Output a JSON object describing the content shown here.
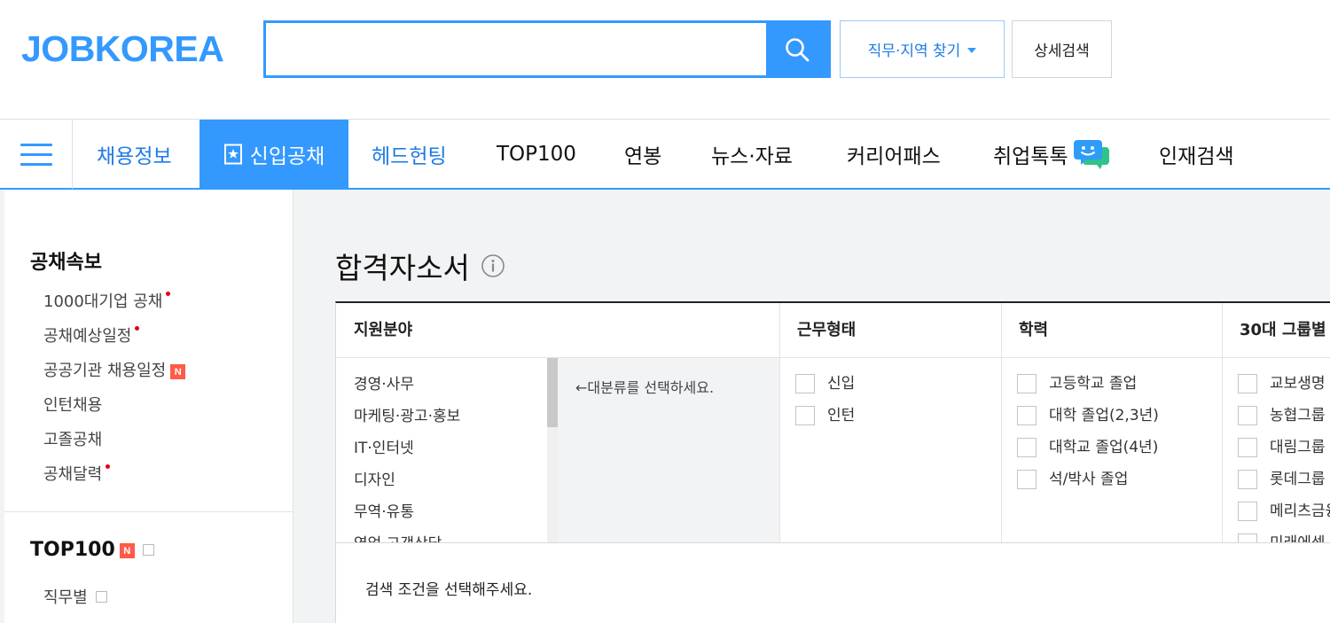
{
  "header": {
    "logo": "JOBKOREA",
    "search_placeholder": "",
    "find_button": "직무·지역 찾기",
    "detail_button": "상세검색"
  },
  "nav": {
    "items": [
      "채용정보",
      "신입공채",
      "헤드헌팅",
      "TOP100",
      "연봉",
      "뉴스·자료",
      "커리어패스",
      "취업톡톡",
      "인재검색"
    ],
    "active": "신입공채"
  },
  "sidebar": {
    "section1_title": "공채속보",
    "section1_items": [
      "1000대기업 공채",
      "공채예상일정",
      "공공기관 채용일정",
      "인턴채용",
      "고졸공채",
      "공채달력"
    ],
    "new_badge": "N",
    "section2_title": "TOP100",
    "section2_items": [
      "직무별"
    ]
  },
  "main": {
    "title": "합격자소서",
    "columns": [
      "지원분야",
      "근무형태",
      "학력",
      "30대 그룹별"
    ],
    "categories": [
      "경영·사무",
      "마케팅·광고·홍보",
      "IT·인터넷",
      "디자인",
      "무역·유통",
      "영업·고객상담"
    ],
    "sub_hint": "←대분류를 선택하세요.",
    "work_types": [
      "신입",
      "인턴"
    ],
    "education": [
      "고등학교 졸업",
      "대학 졸업(2,3년)",
      "대학교 졸업(4년)",
      "석/박사 졸업"
    ],
    "groups": [
      "교보생명",
      "농협그룹",
      "대림그룹",
      "롯데그룹",
      "메리츠금융",
      "미래에셋"
    ],
    "result_message": "검색 조건을 선택해주세요."
  },
  "colors": {
    "brand_blue": "#3399ff",
    "link_blue": "#1e7be4",
    "new_red": "#ff5a4a",
    "dot_red": "#e60012"
  }
}
